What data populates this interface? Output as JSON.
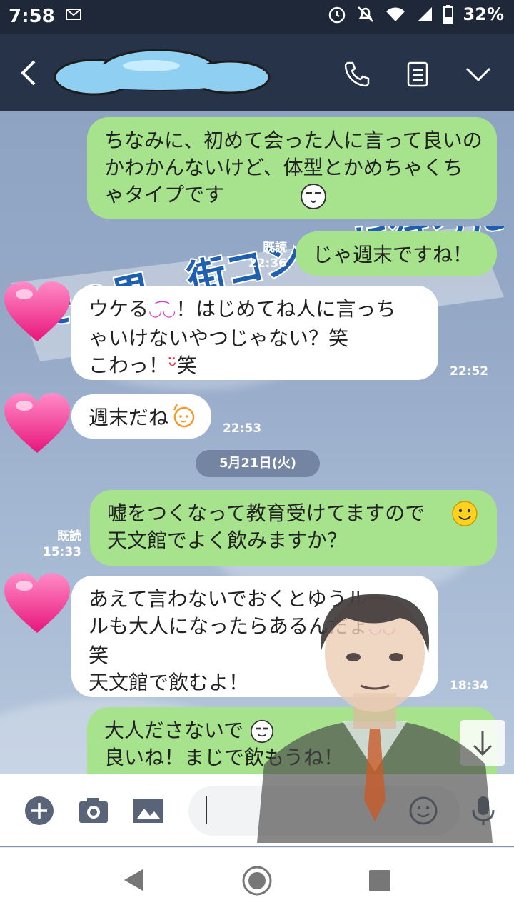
{
  "status_bar": {
    "time": "7:58",
    "battery": "32%"
  },
  "header": {
    "title": ""
  },
  "overlay_banner": {
    "text": "その男、街コン50に行った"
  },
  "messages": [
    {
      "side": "right",
      "text": "ちなみに、初めて会った人に言って良いのかわかんないけど、体型とかめちゃくちゃタイプです",
      "read": "既読",
      "time": ""
    },
    {
      "side": "right",
      "text": "じゃ週末ですね！",
      "read": "既読",
      "time": "22:36"
    },
    {
      "side": "left",
      "line1": "ウケる",
      "line1b": "！はじめてね人に言っち",
      "line2": "ゃいけないやつじゃない？笑",
      "line3a": "こわっ！",
      "line3b": "笑",
      "time": "22:52"
    },
    {
      "side": "left",
      "text": "週末だね",
      "time": "22:53"
    },
    {
      "side": "right",
      "line1": "嘘をつくなって教育受けてますので",
      "line2": "天文館でよく飲みますか？",
      "read": "既読",
      "time": "15:33"
    },
    {
      "side": "left",
      "line1": "あえて言わないでおくとゆうルー",
      "line2": "ルも大人になったらあるんだょ",
      "line3": "笑",
      "line4": "天文館で飲むよ！",
      "time": "18:34"
    },
    {
      "side": "right",
      "line1": "大人ださないで",
      "line2": "良いね！まじで飲もうね！",
      "read": "",
      "time": ""
    }
  ],
  "date_divider": "5月21日(火)",
  "input": {
    "placeholder": "",
    "value": ""
  },
  "icons": [
    "back-icon",
    "phone-icon",
    "notes-icon",
    "chevron-down-icon",
    "plus-icon",
    "camera-icon",
    "image-icon",
    "emoji-icon",
    "mic-icon",
    "scroll-down-icon"
  ],
  "colors": {
    "header": "#273349",
    "bubble_green": "#a6e38c",
    "bubble_white": "#ffffff",
    "chat_bg": "#8ea3c2"
  }
}
